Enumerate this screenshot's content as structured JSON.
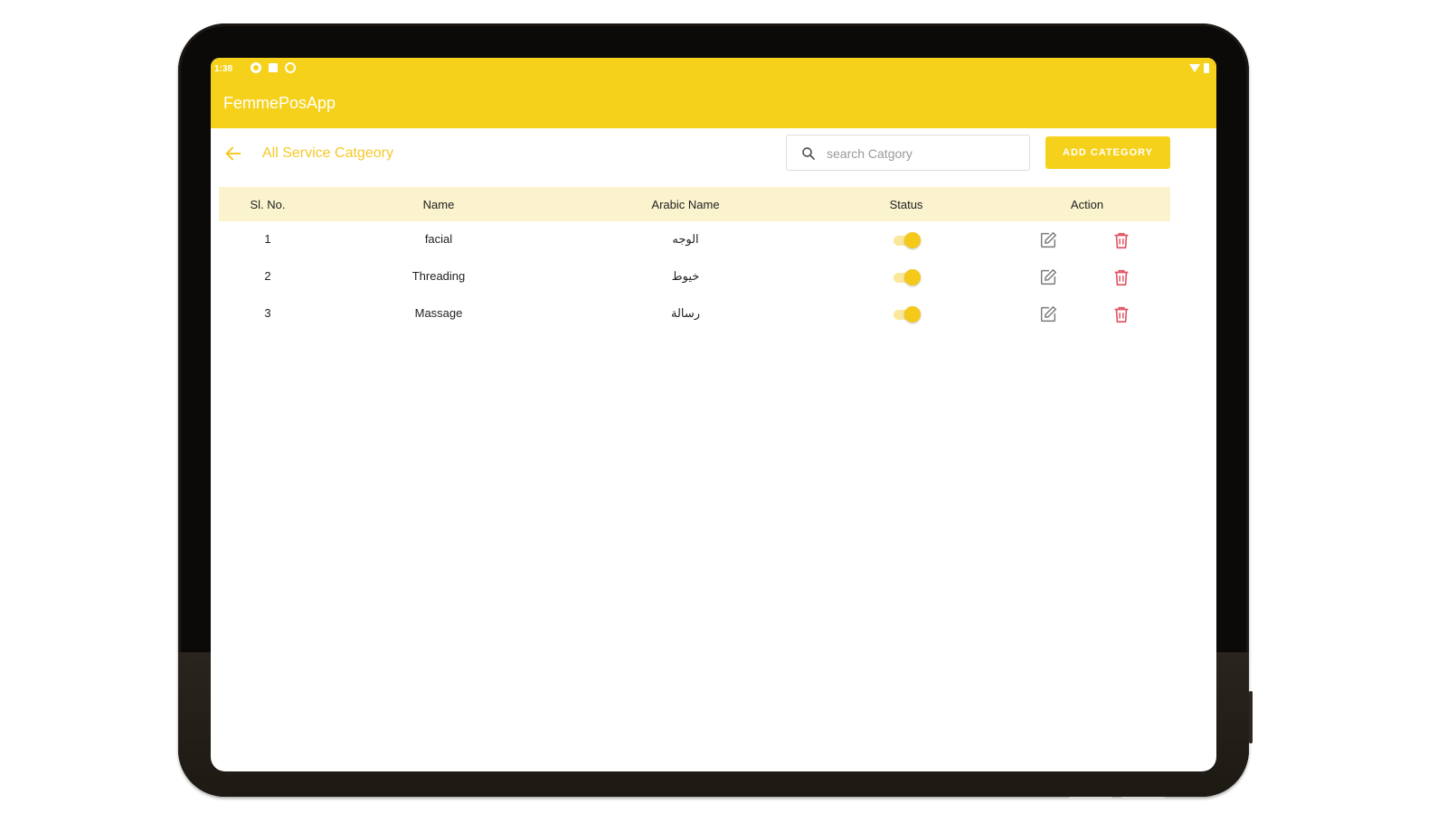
{
  "status_bar": {
    "time": "1:38"
  },
  "app_bar": {
    "title": "FemmePosApp"
  },
  "toolbar": {
    "page_title": "All Service Catgeory",
    "search_placeholder": "search Catgory",
    "search_value": "",
    "add_button_label": "ADD CATEGORY"
  },
  "table": {
    "headers": {
      "sl": "Sl. No.",
      "name": "Name",
      "arabic": "Arabic Name",
      "status": "Status",
      "action": "Action"
    },
    "rows": [
      {
        "sl": "1",
        "name": "facial",
        "arabic": "الوجه",
        "status": true
      },
      {
        "sl": "2",
        "name": "Threading",
        "arabic": "خيوط",
        "status": true
      },
      {
        "sl": "3",
        "name": "Massage",
        "arabic": "رسالة",
        "status": true
      }
    ]
  },
  "colors": {
    "primary": "#f6d11c",
    "header_bg": "#faf3cd",
    "delete": "#e05563",
    "title": "#f4c928"
  }
}
